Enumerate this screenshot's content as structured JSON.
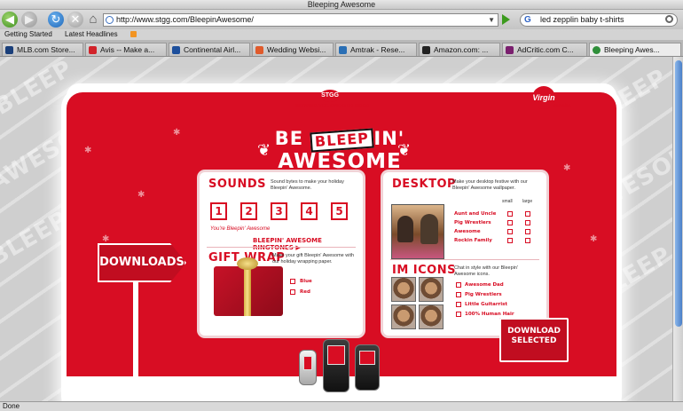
{
  "browser": {
    "window_title": "Bleeping Awesome",
    "url": "http://www.stgg.com/BleepinAwesome/",
    "search_query": "led zepplin baby t-shirts",
    "bookmarks": [
      "Getting Started",
      "Latest Headlines"
    ],
    "tabs": [
      {
        "label": "MLB.com Store...",
        "icon_color": "#1a3f7a",
        "icon": "mlb-icon"
      },
      {
        "label": "Avis -- Make a...",
        "icon_color": "#d2232a",
        "icon": "avis-icon"
      },
      {
        "label": "Continental Airl...",
        "icon_color": "#1d4f9c",
        "icon": "continental-icon"
      },
      {
        "label": "Wedding Websi...",
        "icon_color": "#e05a2b",
        "icon": "wedding-icon"
      },
      {
        "label": "Amtrak - Rese...",
        "icon_color": "#2a6fb5",
        "icon": "amtrak-icon"
      },
      {
        "label": "Amazon.com: ...",
        "icon_color": "#222222",
        "icon": "amazon-icon"
      },
      {
        "label": "AdCritic.com C...",
        "icon_color": "#7a1f6e",
        "icon": "adcritic-icon"
      },
      {
        "label": "Bleeping Awes...",
        "icon_color": "#2f8f3a",
        "icon": "globe-icon",
        "active": true
      }
    ],
    "status": "Done"
  },
  "site": {
    "brand": "STGG",
    "brand_tagline": "SERVING THE GREATER GOOD",
    "partner": "Virgin",
    "partner_sub": "mobile",
    "hero": {
      "line1_a": "BE",
      "bleep": "BLEEP",
      "line1_b": "IN'",
      "line2": "AWESOME"
    },
    "background_words": [
      "BLEEP",
      "AWESOME",
      "BLEEP",
      "BLEEP",
      "AWESOME",
      "BLEEP"
    ],
    "sounds": {
      "title": "SOUNDS",
      "desc": "Sound bytes to make your holiday Bleepin' Awesome.",
      "buttons": [
        "1",
        "2",
        "3",
        "4",
        "5"
      ],
      "caption": "You're Bleepin' Awesome",
      "ringtones_link": "BLEEPIN' AWESOME RINGTONES"
    },
    "giftwrap": {
      "title": "GIFT WRAP",
      "desc": "Make your gift Bleepin' Awesome with our holiday wrapping paper.",
      "options": [
        "Blue",
        "Red"
      ]
    },
    "desktop": {
      "title": "DESKTOP",
      "desc": "Make your desktop festive with our Bleepin' Awesome wallpaper.",
      "col_small": "small",
      "col_large": "large",
      "options": [
        "Aunt and Uncle",
        "Pig Wrestlers",
        "Awesome",
        "Rockin Family"
      ]
    },
    "imicons": {
      "title": "IM ICONS",
      "desc": "Chat in style with our Bleepin' Awesome icons.",
      "options": [
        "Awesome Dad",
        "Pig Wrestlers",
        "Little Guitarrist",
        "100% Human Hair"
      ]
    },
    "downloads_sign": "DOWNLOADS",
    "download_selected": {
      "line1": "DOWNLOAD",
      "line2": "SELECTED"
    }
  },
  "colors": {
    "brand_red": "#d80d23",
    "panel_bg": "#ffffff"
  }
}
